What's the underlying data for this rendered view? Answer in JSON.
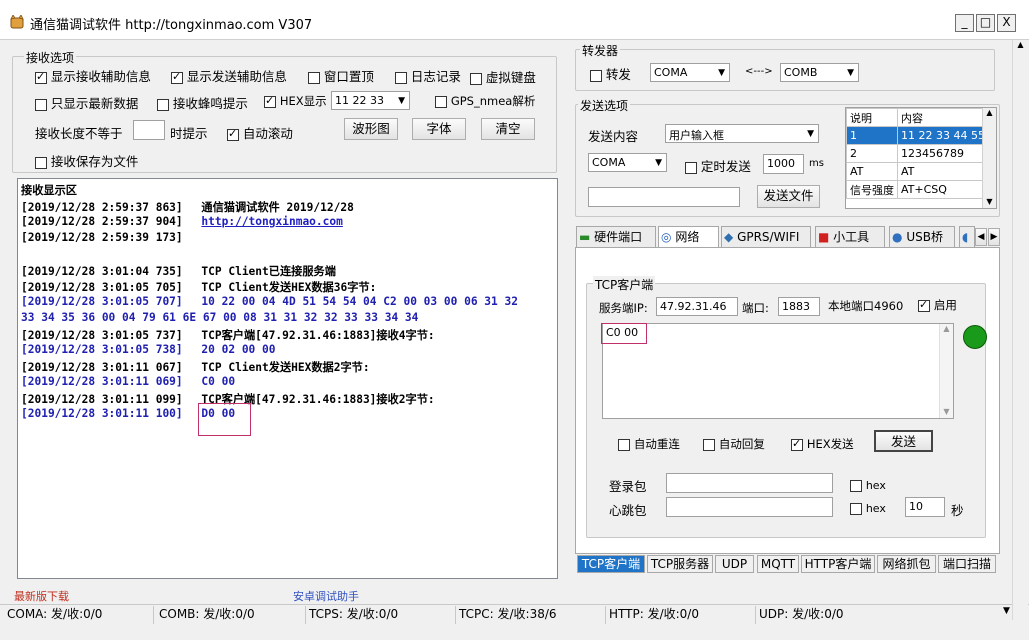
{
  "window": {
    "title": "通信猫调试软件  http://tongxinmao.com  V307",
    "min_label": "_",
    "max_label": "□",
    "close_label": "X"
  },
  "recv_options": {
    "legend": "接收选项",
    "show_recv_aux": "显示接收辅助信息",
    "show_send_aux": "显示发送辅助信息",
    "window_top": "窗口置顶",
    "log": "日志记录",
    "virtual_keyboard": "虚拟键盘",
    "only_latest": "只显示最新数据",
    "recv_beep": "接收蜂鸣提示",
    "hex_display": "HEX显示",
    "hex_select_value": "11 22 33",
    "gps_parse": "GPS_nmea解析",
    "length_not_equal": "接收长度不等于",
    "length_value": "",
    "prompt": "时提示",
    "auto_scroll": "自动滚动",
    "waveform_btn": "波形图",
    "font_btn": "字体",
    "clear_btn": "清空",
    "save_to_file": "接收保存为文件"
  },
  "recv_display": {
    "heading": "接收显示区",
    "lines": [
      {
        "ts": "[2019/12/28 2:59:37 863]",
        "text": "通信猫调试软件     2019/12/28"
      },
      {
        "ts": "[2019/12/28 2:59:37 904]",
        "text": "http://tongxinmao.com"
      },
      {
        "ts": "[2019/12/28 2:59:39 173]",
        "text": ""
      },
      {
        "ts": "[2019/12/28 3:01:04 735]",
        "text": "TCP Client已连接服务端"
      },
      {
        "ts": "[2019/12/28 3:01:05 705]",
        "text": "TCP Client发送HEX数据36字节:"
      },
      {
        "ts": "[2019/12/28 3:01:05 707]",
        "text": "10 22 00 04 4D 51 54 54 04 C2 00 03 00 06 31 32"
      },
      {
        "ts": "",
        "text": "33 34 35 36 00 04 79 61 6E 67 00 08 31 31 32 32 33 33 34 34"
      },
      {
        "ts": "[2019/12/28 3:01:05 737]",
        "text": "TCP客户端[47.92.31.46:1883]接收4字节:"
      },
      {
        "ts": "[2019/12/28 3:01:05 738]",
        "text": "20 02 00 00"
      },
      {
        "ts": "[2019/12/28 3:01:11 067]",
        "text": "TCP Client发送HEX数据2字节:"
      },
      {
        "ts": "[2019/12/28 3:01:11 069]",
        "text": "C0 00"
      },
      {
        "ts": "[2019/12/28 3:01:11 099]",
        "text": "TCP客户端[47.92.31.46:1883]接收2字节:"
      },
      {
        "ts": "[2019/12/28 3:01:11 100]",
        "text": "D0 00"
      }
    ]
  },
  "forwarder": {
    "legend": "转发器",
    "forward": "转发",
    "port_a": "COMA",
    "arrow": "<--->",
    "port_b": "COMB"
  },
  "send_options": {
    "legend": "发送选项",
    "content_label": "发送内容",
    "content_value": "用户输入框",
    "port": "COMA",
    "timed_send": "定时发送",
    "interval": "1000",
    "ms": "ms",
    "file_value": "",
    "send_file_btn": "发送文件",
    "table_headers": [
      "说明",
      "内容"
    ],
    "table_rows": [
      [
        "1",
        "11 22 33 44 55"
      ],
      [
        "2",
        "123456789"
      ],
      [
        "AT",
        "AT"
      ],
      [
        "信号强度",
        "AT+CSQ"
      ]
    ]
  },
  "top_tabs": [
    "硬件端口",
    "网络",
    "GPRS/WIFI",
    "小工具",
    "USB桥"
  ],
  "tcp_client": {
    "legend": "TCP客户端",
    "server_ip_label": "服务端IP:",
    "server_ip": "47.92.31.46",
    "port_label": "端口:",
    "port": "1883",
    "local_port": "本地端口4960",
    "enable": "启用",
    "send_text": "C0 00",
    "auto_reconnect": "自动重连",
    "auto_reply": "自动回复",
    "hex_send": "HEX发送",
    "send_btn": "发送",
    "login_label": "登录包",
    "login_value": "",
    "heartbeat_label": "心跳包",
    "heartbeat_value": "",
    "hex": "hex",
    "heartbeat_interval": "10",
    "seconds": "秒"
  },
  "bottom_tabs": [
    "TCP客户端",
    "TCP服务器",
    "UDP",
    "MQTT",
    "HTTP客户端",
    "网络抓包",
    "端口扫描"
  ],
  "footer_links": {
    "download": "最新版下载",
    "android": "安卓调试助手"
  },
  "status_bar": [
    "COMA: 发/收:0/0",
    "COMB: 发/收:0/0",
    "TCPS: 发/收:0/0",
    "TCPC: 发/收:38/6",
    "HTTP: 发/收:0/0",
    "UDP: 发/收:0/0"
  ],
  "colors": {
    "active_tab": "#2074c8",
    "status_connected": "#1a9a1a",
    "highlight_box": "#c0306a",
    "footer_link_red": "#c03020",
    "footer_link_blue": "#3050c0"
  }
}
